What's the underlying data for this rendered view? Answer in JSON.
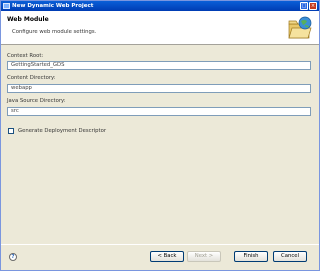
{
  "window": {
    "title": "New Dynamic Web Project"
  },
  "banner": {
    "title": "Web Module",
    "description": "Configure web module settings."
  },
  "form": {
    "context_root": {
      "label": "Context Root:",
      "value": "GettingStarted_GDS"
    },
    "content_directory": {
      "label": "Content Directory:",
      "value": "webapp"
    },
    "java_source_directory": {
      "label": "Java Source Directory:",
      "value": "src"
    },
    "generate_descriptor": {
      "label": "Generate Deployment Descriptor",
      "checked": false
    }
  },
  "buttons": {
    "help": "?",
    "back": "< Back",
    "next": "Next >",
    "finish": "Finish",
    "cancel": "Cancel"
  },
  "colors": {
    "titlebar": "#0a5fd8",
    "banner_bg": "#ffffff",
    "dialog_bg": "#ece9d8"
  }
}
